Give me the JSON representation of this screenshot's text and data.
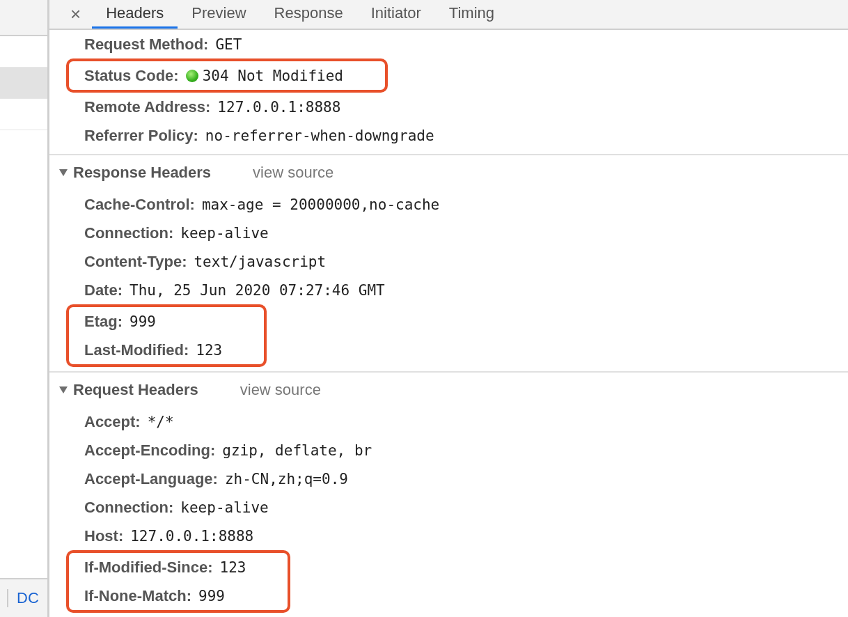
{
  "left_panel": {
    "rows": [
      {
        "selected": false
      },
      {
        "selected": true
      },
      {
        "selected": false
      }
    ],
    "status_text": "DC"
  },
  "close_button": "×",
  "tabs": [
    {
      "label": "Headers",
      "selected": true
    },
    {
      "label": "Preview",
      "selected": false
    },
    {
      "label": "Response",
      "selected": false
    },
    {
      "label": "Initiator",
      "selected": false
    },
    {
      "label": "Timing",
      "selected": false
    }
  ],
  "sections": [
    {
      "rows": [
        {
          "name": "Request Method:",
          "value": "GET",
          "highlighted": false
        },
        {
          "name": "Status Code:",
          "value": "304 Not Modified",
          "status_dot": true,
          "highlighted": true
        },
        {
          "name": "Remote Address:",
          "value": "127.0.0.1:8888",
          "highlighted": false
        },
        {
          "name": "Referrer Policy:",
          "value": "no-referrer-when-downgrade",
          "highlighted": false
        }
      ]
    },
    {
      "title": "Response Headers",
      "expanded": true,
      "link": "view source",
      "rows": [
        {
          "name": "Cache-Control:",
          "value": "max-age = 20000000,no-cache",
          "highlighted": false
        },
        {
          "name": "Connection:",
          "value": "keep-alive",
          "highlighted": false
        },
        {
          "name": "Content-Type:",
          "value": "text/javascript",
          "highlighted": false
        },
        {
          "name": "Date:",
          "value": "Thu, 25 Jun 2020 07:27:46 GMT",
          "highlighted": false
        },
        {
          "name": "Etag:",
          "value": "999",
          "highlighted": true
        },
        {
          "name": "Last-Modified:",
          "value": "123",
          "highlighted": true
        }
      ]
    },
    {
      "title": "Request Headers",
      "expanded": true,
      "link": "view source",
      "rows": [
        {
          "name": "Accept:",
          "value": "*/*",
          "highlighted": false
        },
        {
          "name": "Accept-Encoding:",
          "value": "gzip, deflate, br",
          "highlighted": false
        },
        {
          "name": "Accept-Language:",
          "value": "zh-CN,zh;q=0.9",
          "highlighted": false
        },
        {
          "name": "Connection:",
          "value": "keep-alive",
          "highlighted": false
        },
        {
          "name": "Host:",
          "value": "127.0.0.1:8888",
          "highlighted": false
        },
        {
          "name": "If-Modified-Since:",
          "value": "123",
          "highlighted": true
        },
        {
          "name": "If-None-Match:",
          "value": "999",
          "highlighted": true
        }
      ]
    }
  ]
}
